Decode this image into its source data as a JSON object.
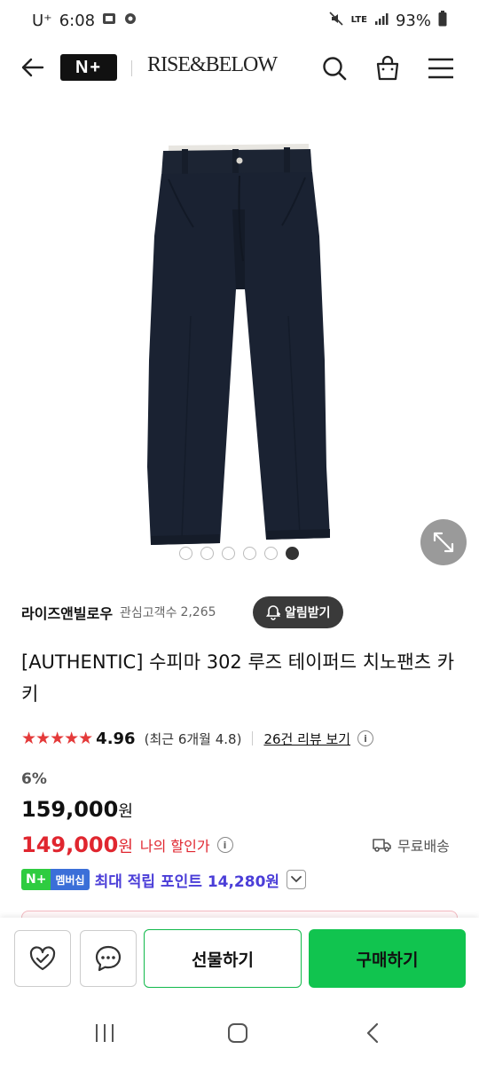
{
  "status_bar": {
    "carrier": "U⁺",
    "time": "6:08",
    "network": "LTE",
    "battery": "93%"
  },
  "header": {
    "np_logo": "N+",
    "brand": "RISE&BELOW"
  },
  "gallery": {
    "slide_count": 6,
    "active_slide": 6
  },
  "store": {
    "name": "라이즈앤빌로우",
    "follower_label": "관심고객수",
    "follower_count": "2,265",
    "alarm_label": "알림받기"
  },
  "product": {
    "title": "[AUTHENTIC] 수피마 302 루즈 테이퍼드 치노팬츠 카키"
  },
  "rating": {
    "stars": "★★★★★",
    "score": "4.96",
    "recent": "(최근 6개월 4.8)",
    "review_link": "26건 리뷰 보기"
  },
  "price": {
    "discount": "6%",
    "original_amount": "159,000",
    "sale_amount": "149,000",
    "currency": "원",
    "my_discount": "나의 할인가",
    "shipping": "무료배송"
  },
  "points": {
    "badge_np": "N+",
    "badge_label": "멤버십",
    "text": "최대 적립 포인트 14,280원"
  },
  "buy_bar": {
    "gift_label": "선물하기",
    "purchase_label": "구매하기"
  },
  "colors": {
    "accent_green": "#11c44f",
    "sale_red": "#e0262f",
    "points_purple": "#4b3ed8"
  }
}
